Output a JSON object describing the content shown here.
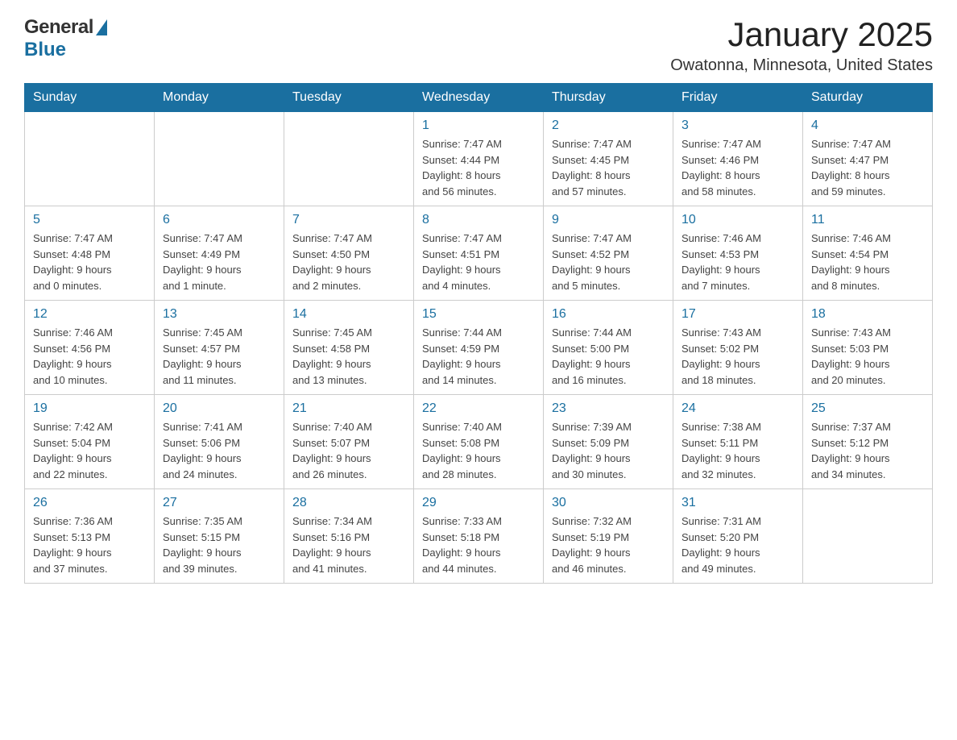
{
  "header": {
    "logo": {
      "general": "General",
      "blue": "Blue"
    },
    "title": "January 2025",
    "subtitle": "Owatonna, Minnesota, United States"
  },
  "weekdays": [
    "Sunday",
    "Monday",
    "Tuesday",
    "Wednesday",
    "Thursday",
    "Friday",
    "Saturday"
  ],
  "weeks": [
    [
      {
        "day": "",
        "info": ""
      },
      {
        "day": "",
        "info": ""
      },
      {
        "day": "",
        "info": ""
      },
      {
        "day": "1",
        "info": "Sunrise: 7:47 AM\nSunset: 4:44 PM\nDaylight: 8 hours\nand 56 minutes."
      },
      {
        "day": "2",
        "info": "Sunrise: 7:47 AM\nSunset: 4:45 PM\nDaylight: 8 hours\nand 57 minutes."
      },
      {
        "day": "3",
        "info": "Sunrise: 7:47 AM\nSunset: 4:46 PM\nDaylight: 8 hours\nand 58 minutes."
      },
      {
        "day": "4",
        "info": "Sunrise: 7:47 AM\nSunset: 4:47 PM\nDaylight: 8 hours\nand 59 minutes."
      }
    ],
    [
      {
        "day": "5",
        "info": "Sunrise: 7:47 AM\nSunset: 4:48 PM\nDaylight: 9 hours\nand 0 minutes."
      },
      {
        "day": "6",
        "info": "Sunrise: 7:47 AM\nSunset: 4:49 PM\nDaylight: 9 hours\nand 1 minute."
      },
      {
        "day": "7",
        "info": "Sunrise: 7:47 AM\nSunset: 4:50 PM\nDaylight: 9 hours\nand 2 minutes."
      },
      {
        "day": "8",
        "info": "Sunrise: 7:47 AM\nSunset: 4:51 PM\nDaylight: 9 hours\nand 4 minutes."
      },
      {
        "day": "9",
        "info": "Sunrise: 7:47 AM\nSunset: 4:52 PM\nDaylight: 9 hours\nand 5 minutes."
      },
      {
        "day": "10",
        "info": "Sunrise: 7:46 AM\nSunset: 4:53 PM\nDaylight: 9 hours\nand 7 minutes."
      },
      {
        "day": "11",
        "info": "Sunrise: 7:46 AM\nSunset: 4:54 PM\nDaylight: 9 hours\nand 8 minutes."
      }
    ],
    [
      {
        "day": "12",
        "info": "Sunrise: 7:46 AM\nSunset: 4:56 PM\nDaylight: 9 hours\nand 10 minutes."
      },
      {
        "day": "13",
        "info": "Sunrise: 7:45 AM\nSunset: 4:57 PM\nDaylight: 9 hours\nand 11 minutes."
      },
      {
        "day": "14",
        "info": "Sunrise: 7:45 AM\nSunset: 4:58 PM\nDaylight: 9 hours\nand 13 minutes."
      },
      {
        "day": "15",
        "info": "Sunrise: 7:44 AM\nSunset: 4:59 PM\nDaylight: 9 hours\nand 14 minutes."
      },
      {
        "day": "16",
        "info": "Sunrise: 7:44 AM\nSunset: 5:00 PM\nDaylight: 9 hours\nand 16 minutes."
      },
      {
        "day": "17",
        "info": "Sunrise: 7:43 AM\nSunset: 5:02 PM\nDaylight: 9 hours\nand 18 minutes."
      },
      {
        "day": "18",
        "info": "Sunrise: 7:43 AM\nSunset: 5:03 PM\nDaylight: 9 hours\nand 20 minutes."
      }
    ],
    [
      {
        "day": "19",
        "info": "Sunrise: 7:42 AM\nSunset: 5:04 PM\nDaylight: 9 hours\nand 22 minutes."
      },
      {
        "day": "20",
        "info": "Sunrise: 7:41 AM\nSunset: 5:06 PM\nDaylight: 9 hours\nand 24 minutes."
      },
      {
        "day": "21",
        "info": "Sunrise: 7:40 AM\nSunset: 5:07 PM\nDaylight: 9 hours\nand 26 minutes."
      },
      {
        "day": "22",
        "info": "Sunrise: 7:40 AM\nSunset: 5:08 PM\nDaylight: 9 hours\nand 28 minutes."
      },
      {
        "day": "23",
        "info": "Sunrise: 7:39 AM\nSunset: 5:09 PM\nDaylight: 9 hours\nand 30 minutes."
      },
      {
        "day": "24",
        "info": "Sunrise: 7:38 AM\nSunset: 5:11 PM\nDaylight: 9 hours\nand 32 minutes."
      },
      {
        "day": "25",
        "info": "Sunrise: 7:37 AM\nSunset: 5:12 PM\nDaylight: 9 hours\nand 34 minutes."
      }
    ],
    [
      {
        "day": "26",
        "info": "Sunrise: 7:36 AM\nSunset: 5:13 PM\nDaylight: 9 hours\nand 37 minutes."
      },
      {
        "day": "27",
        "info": "Sunrise: 7:35 AM\nSunset: 5:15 PM\nDaylight: 9 hours\nand 39 minutes."
      },
      {
        "day": "28",
        "info": "Sunrise: 7:34 AM\nSunset: 5:16 PM\nDaylight: 9 hours\nand 41 minutes."
      },
      {
        "day": "29",
        "info": "Sunrise: 7:33 AM\nSunset: 5:18 PM\nDaylight: 9 hours\nand 44 minutes."
      },
      {
        "day": "30",
        "info": "Sunrise: 7:32 AM\nSunset: 5:19 PM\nDaylight: 9 hours\nand 46 minutes."
      },
      {
        "day": "31",
        "info": "Sunrise: 7:31 AM\nSunset: 5:20 PM\nDaylight: 9 hours\nand 49 minutes."
      },
      {
        "day": "",
        "info": ""
      }
    ]
  ]
}
